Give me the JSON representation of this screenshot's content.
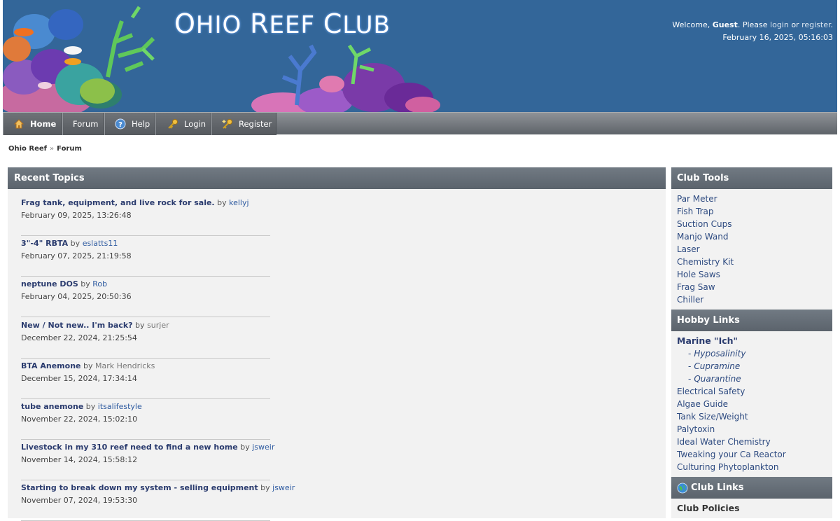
{
  "header": {
    "site_title_parts": [
      {
        "cap": "O",
        "rest": "HIO "
      },
      {
        "cap": "R",
        "rest": "EEF "
      },
      {
        "cap": "C",
        "rest": "LUB"
      }
    ],
    "welcome_prefix": "Welcome, ",
    "welcome_user": "Guest",
    "welcome_mid": ". Please ",
    "login_link": "login",
    "or_text": " or ",
    "register_link": "register",
    "period": ".",
    "datetime": "February 16, 2025, 05:16:03"
  },
  "nav": {
    "items": [
      {
        "label": "Home",
        "icon": "home-icon"
      },
      {
        "label": "Forum",
        "icon": ""
      },
      {
        "label": "Help",
        "icon": "help-icon"
      },
      {
        "label": "Login",
        "icon": "key-icon"
      },
      {
        "label": "Register",
        "icon": "key-add-icon"
      }
    ]
  },
  "breadcrumb": {
    "items": [
      "Ohio Reef",
      "Forum"
    ],
    "separator": "»"
  },
  "recent_topics": {
    "heading": "Recent Topics",
    "by_word": " by ",
    "topics": [
      {
        "title": "Frag tank, equipment, and live rock for sale.",
        "user": "kellyj",
        "date": "February 09, 2025, 13:26:48",
        "guest": false
      },
      {
        "title": "3\"-4\" RBTA",
        "user": "eslatts11",
        "date": "February 07, 2025, 21:19:58",
        "guest": false
      },
      {
        "title": "neptune DOS",
        "user": "Rob",
        "date": "February 04, 2025, 20:50:36",
        "guest": false
      },
      {
        "title": "New / Not new.. I'm back?",
        "user": "surjer",
        "date": "December 22, 2024, 21:25:54",
        "guest": true
      },
      {
        "title": "BTA Anemone",
        "user": "Mark Hendricks",
        "date": "December 15, 2024, 17:34:14",
        "guest": true
      },
      {
        "title": "tube anemone",
        "user": "itsalifestyle",
        "date": "November 22, 2024, 15:02:10",
        "guest": false
      },
      {
        "title": "Livestock in my 310 reef need to find a new home",
        "user": "jsweir",
        "date": "November 14, 2024, 15:58:12",
        "guest": false
      },
      {
        "title": "Starting to break down my system - selling equipment",
        "user": "jsweir",
        "date": "November 07, 2024, 19:53:30",
        "guest": false
      }
    ]
  },
  "club_tools": {
    "heading": "Club Tools",
    "items": [
      "Par Meter",
      "Fish Trap",
      "Suction Cups",
      "Manjo Wand",
      "Laser",
      "Chemistry Kit",
      "Hole Saws",
      "Frag Saw",
      "Chiller"
    ]
  },
  "hobby_links": {
    "heading": "Hobby Links",
    "ich_title": "Marine \"Ich\"",
    "ich_subs": [
      "Hyposalinity",
      "Cupramine",
      "Quarantine"
    ],
    "items": [
      "Electrical Safety",
      "Algae Guide",
      "Tank Size/Weight",
      "Palytoxin",
      "Ideal Water Chemistry",
      "Tweaking your Ca Reactor",
      "Culturing Phytoplankton"
    ]
  },
  "club_links": {
    "heading": "Club Links",
    "items": [
      "Club Policies"
    ]
  },
  "colors": {
    "header_bg": "#336699",
    "nav_bg": "#5e6369",
    "panel_head": "#5b636c",
    "link": "#2d4a80"
  }
}
